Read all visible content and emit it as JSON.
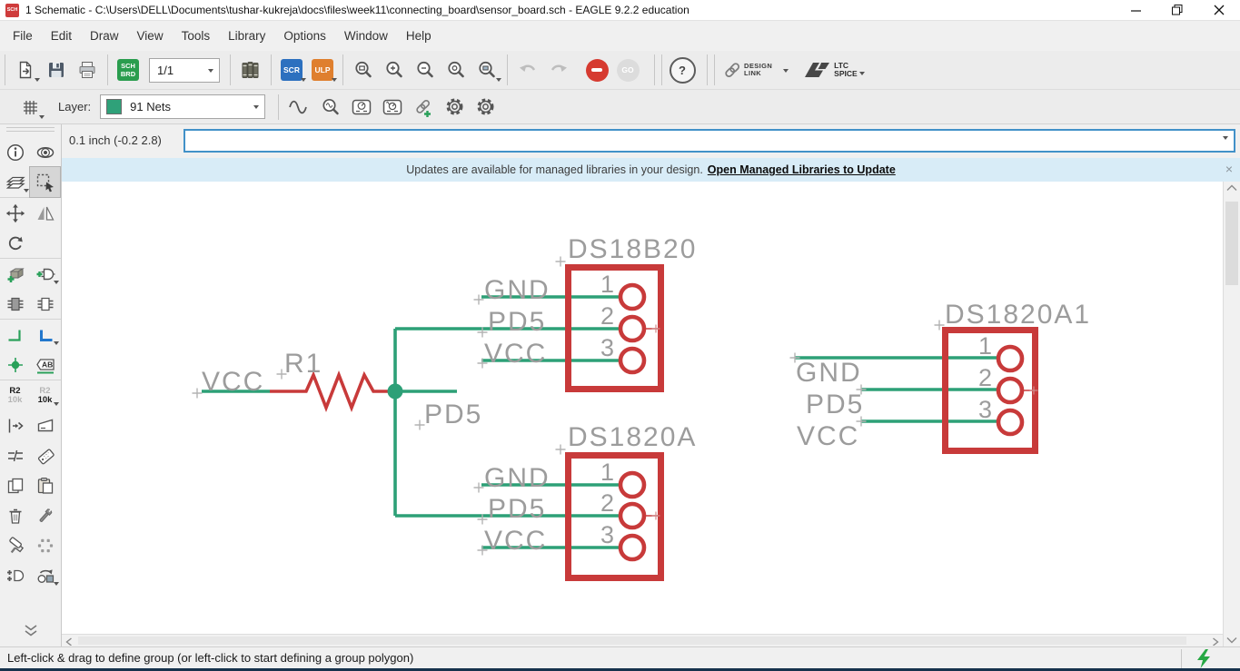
{
  "titlebar": {
    "title": "1 Schematic - C:\\Users\\DELL\\Documents\\tushar-kukreja\\docs\\files\\week11\\connecting_board\\sensor_board.sch - EAGLE 9.2.2 education",
    "icon_text": "SCH"
  },
  "menubar": {
    "items": [
      "File",
      "Edit",
      "Draw",
      "View",
      "Tools",
      "Library",
      "Options",
      "Window",
      "Help"
    ]
  },
  "toolbar": {
    "sheet_selector": "1/1",
    "sch_badge_top": "SCH",
    "sch_badge_bottom": "BRD",
    "scr_label": "SCR",
    "ulp_label": "ULP",
    "go_label": "GO",
    "help_label": "?",
    "design_link_line1": "DESIGN",
    "design_link_line2": "LINK",
    "ltc_line1": "LTC",
    "ltc_line2": "SPICE"
  },
  "layerbar": {
    "label": "Layer:",
    "selected_layer": "91 Nets",
    "swatch_color": "#2fa179"
  },
  "coordbar": {
    "readout": "0.1 inch (-0.2 2.8)",
    "command_value": ""
  },
  "banner": {
    "message": "Updates are available for managed libraries in your design.",
    "link_label": "Open Managed Libraries to Update",
    "close_label": "×"
  },
  "sidebar": {
    "name_button": {
      "ref": "R2",
      "value": "10k"
    },
    "value_button": {
      "ref": "R2",
      "value": "10k"
    },
    "label_tool_text": "AB"
  },
  "statusbar": {
    "hint": "Left-click & drag to define group (or left-click to start defining a group polygon)"
  },
  "schematic": {
    "components": [
      {
        "name": "DS18B20",
        "pins": [
          {
            "number": "1",
            "net": "GND"
          },
          {
            "number": "2",
            "net": "PD5"
          },
          {
            "number": "3",
            "net": "VCC"
          }
        ]
      },
      {
        "name": "DS1820A",
        "pins": [
          {
            "number": "1",
            "net": "GND"
          },
          {
            "number": "2",
            "net": "PD5"
          },
          {
            "number": "3",
            "net": "VCC"
          }
        ]
      },
      {
        "name": "DS1820A1",
        "pins": [
          {
            "number": "1",
            "net": "GND"
          },
          {
            "number": "2",
            "net": "PD5"
          },
          {
            "number": "3",
            "net": "VCC"
          }
        ]
      }
    ],
    "resistor": {
      "name": "R1",
      "input_net": "VCC",
      "output_net": "PD5"
    },
    "colors": {
      "component_outline": "#c83a3a",
      "net_wire": "#2da077",
      "text_gray": "#9c9c9c"
    }
  }
}
